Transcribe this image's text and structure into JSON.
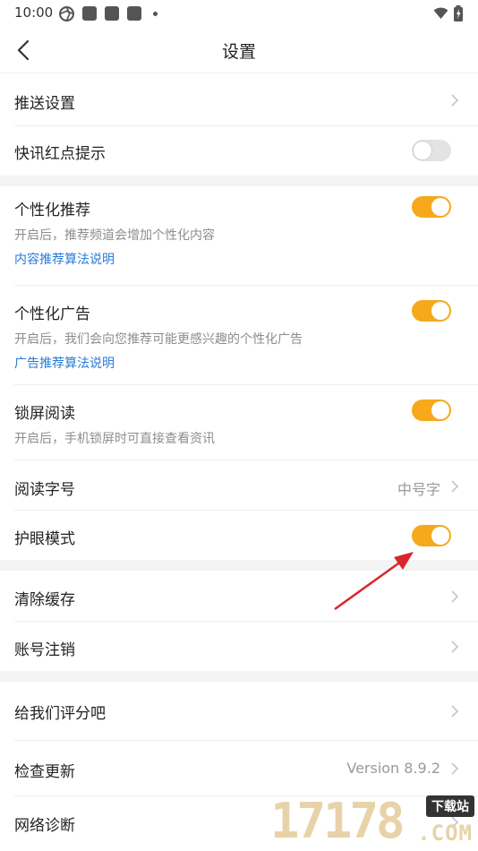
{
  "status_bar": {
    "time": "10:00",
    "icons": [
      "aperture-icon",
      "app-icon",
      "app-icon",
      "app-icon",
      "dot-icon",
      "wifi-icon",
      "battery-icon"
    ]
  },
  "header": {
    "title": "设置"
  },
  "sections": [
    {
      "items": [
        {
          "label": "推送设置",
          "control": "chevron"
        },
        {
          "label": "快讯红点提示",
          "control": "toggle",
          "enabled": false
        }
      ]
    },
    {
      "items": [
        {
          "label": "个性化推荐",
          "subtitle": "开启后，推荐频道会增加个性化内容",
          "link": "内容推荐算法说明",
          "control": "toggle",
          "enabled": true
        },
        {
          "label": "个性化广告",
          "subtitle": "开启后，我们会向您推荐可能更感兴趣的个性化广告",
          "link": "广告推荐算法说明",
          "control": "toggle",
          "enabled": true
        },
        {
          "label": "锁屏阅读",
          "subtitle": "开启后，手机锁屏时可直接查看资讯",
          "control": "toggle",
          "enabled": true
        },
        {
          "label": "阅读字号",
          "value": "中号字",
          "control": "chevron"
        },
        {
          "label": "护眼模式",
          "control": "toggle",
          "enabled": true
        }
      ]
    },
    {
      "items": [
        {
          "label": "清除缓存",
          "control": "chevron"
        },
        {
          "label": "账号注销",
          "control": "chevron"
        }
      ]
    },
    {
      "items": [
        {
          "label": "给我们评分吧",
          "control": "chevron"
        },
        {
          "label": "检查更新",
          "value": "Version 8.9.2",
          "control": "chevron"
        },
        {
          "label": "网络诊断",
          "control": "chevron"
        }
      ]
    }
  ],
  "watermark": {
    "digits": "17178",
    "badge": "下载站",
    "suffix": ".COM"
  },
  "colors": {
    "accent": "#f7a81b",
    "link": "#2a7bd6",
    "arrow": "#d8262b",
    "divider": "#eeeeee",
    "section_gap": "#f4f4f4"
  }
}
